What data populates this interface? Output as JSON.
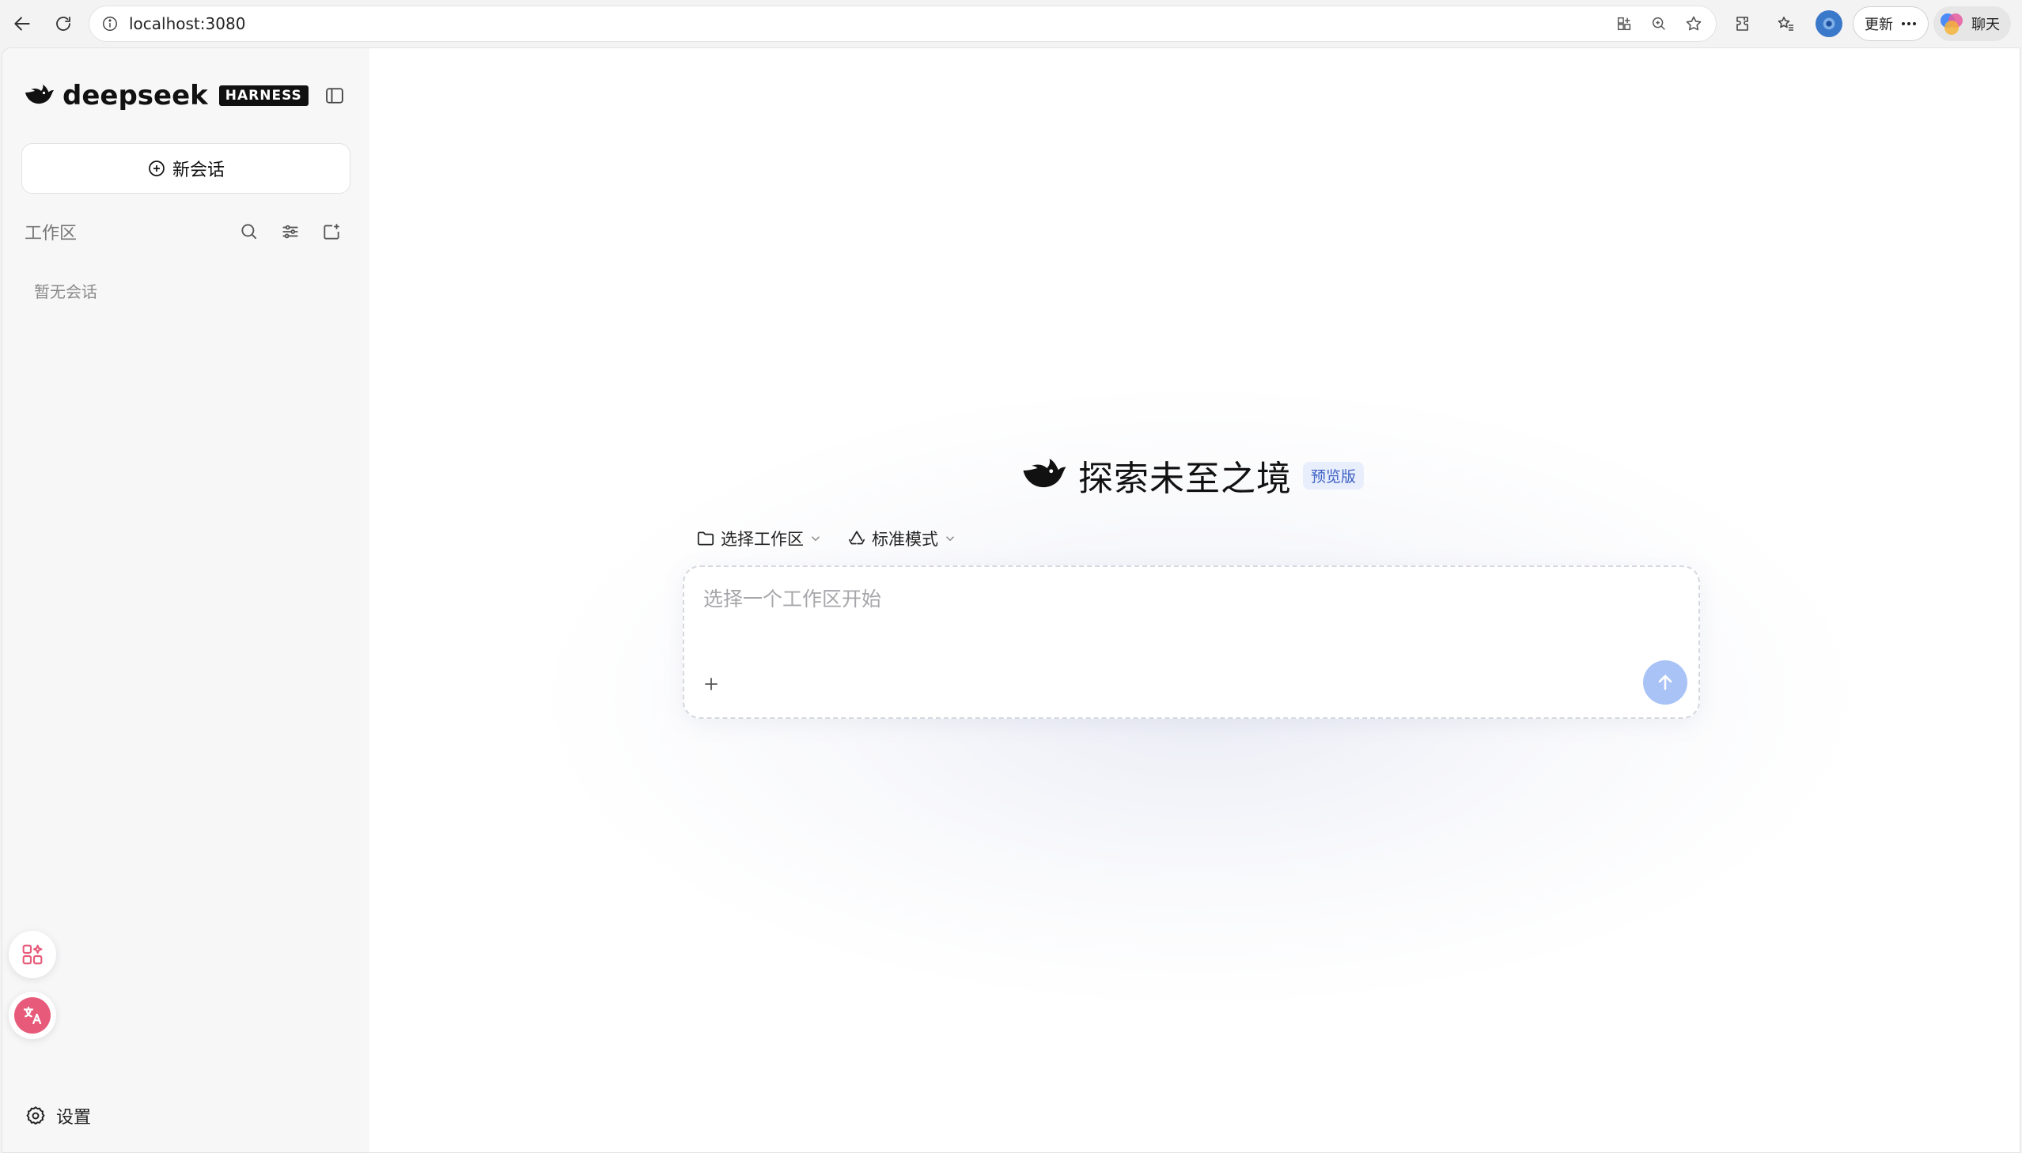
{
  "browser": {
    "url": "localhost:3080",
    "update_label": "更新",
    "chat_label": "聊天"
  },
  "sidebar": {
    "brand_word": "deepseek",
    "brand_tag": "HARNESS",
    "new_chat_label": "新会话",
    "workspace_label": "工作区",
    "empty_text": "暂无会话",
    "settings_label": "设置"
  },
  "main": {
    "hero_title": "探索未至之境",
    "hero_badge": "预览版",
    "workspace_select_label": "选择工作区",
    "mode_select_label": "标准模式",
    "composer_placeholder": "选择一个工作区开始"
  },
  "colors": {
    "accent": "#3b5fc4",
    "badge_bg": "#e8eefb",
    "send_button": "#a9c3f7",
    "sidebar_bg": "#f7f7f8",
    "translate_pink": "#e85a7a"
  }
}
